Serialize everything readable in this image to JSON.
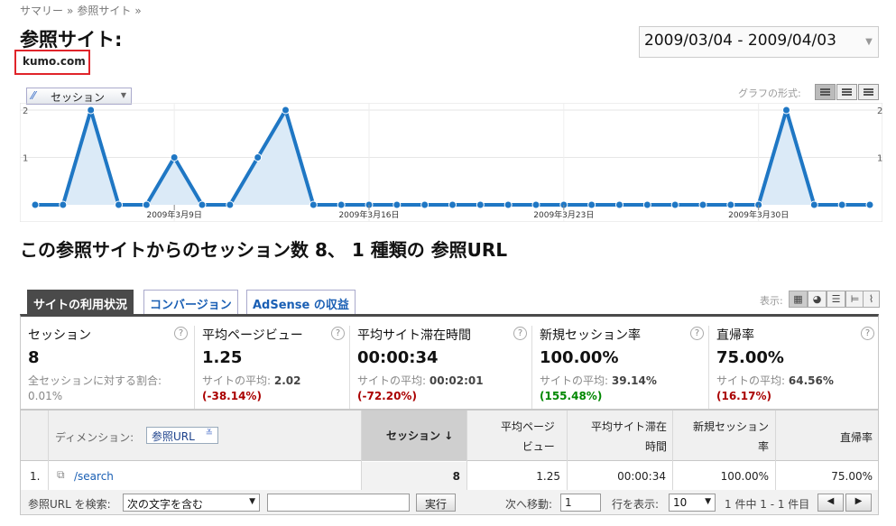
{
  "breadcrumb": {
    "items": [
      "サマリー",
      "参照サイト"
    ],
    "separator": "»"
  },
  "page": {
    "title": "参照サイト:",
    "site": "kumo.com"
  },
  "date_range": {
    "text": "2009/03/04 - 2009/04/03"
  },
  "graph": {
    "metric_label": "セッション",
    "type_label": "グラフの形式:",
    "y_ticks": [
      "2",
      "1"
    ],
    "x_tick_labels": [
      "2009年3月9日",
      "2009年3月16日",
      "2009年3月23日",
      "2009年3月30日"
    ],
    "line_color": "#1f77c4",
    "fill_color": "#dbeaf7"
  },
  "chart_data": {
    "type": "area",
    "series": [
      {
        "values": [
          0,
          0,
          2,
          0,
          0,
          1,
          0,
          0,
          1,
          2,
          0,
          0,
          0,
          0,
          0,
          0,
          0,
          0,
          0,
          0,
          0,
          0,
          0,
          0,
          0,
          0,
          0,
          2,
          0,
          0,
          0
        ]
      }
    ],
    "x": [
      "3/4",
      "3/5",
      "3/6",
      "3/7",
      "3/8",
      "3/9",
      "3/10",
      "3/11",
      "3/12",
      "3/13",
      "3/14",
      "3/15",
      "3/16",
      "3/17",
      "3/18",
      "3/19",
      "3/20",
      "3/21",
      "3/22",
      "3/23",
      "3/24",
      "3/25",
      "3/26",
      "3/27",
      "3/28",
      "3/29",
      "3/30",
      "3/31",
      "4/1",
      "4/2",
      "4/3"
    ],
    "x_tick_labels": [
      "2009年3月9日",
      "2009年3月16日",
      "2009年3月23日",
      "2009年3月30日"
    ],
    "ylim": [
      0,
      2
    ],
    "y_ticks": [
      1,
      2
    ],
    "grid": true
  },
  "summary": {
    "title": "この参照サイトからのセッション数 8、 1 種類の 参照URL"
  },
  "tabs": [
    {
      "label": "サイトの利用状況",
      "active": true
    },
    {
      "label": "コンバージョン",
      "active": false
    },
    {
      "label": "AdSense の収益",
      "active": false
    }
  ],
  "view": {
    "label": "表示:"
  },
  "scorecard": [
    {
      "title": "セッション",
      "value": "8",
      "sub_label": "全セッションに対する割合:",
      "sub_value": "0.01%",
      "pct": ""
    },
    {
      "title": "平均ページビュー",
      "value": "1.25",
      "sub_label": "サイトの平均:",
      "sub_value": "2.02",
      "pct": "(-38.14%)"
    },
    {
      "title": "平均サイト滞在時間",
      "value": "00:00:34",
      "sub_label": "サイトの平均:",
      "sub_value": "00:02:01",
      "pct": "(-72.20%)"
    },
    {
      "title": "新規セッション率",
      "value": "100.00%",
      "sub_label": "サイトの平均:",
      "sub_value": "39.14%",
      "pct": "(155.48%)"
    },
    {
      "title": "直帰率",
      "value": "75.00%",
      "sub_label": "サイトの平均:",
      "sub_value": "64.56%",
      "pct": "(16.17%)"
    }
  ],
  "table": {
    "dimension_label": "ディメンション:",
    "dimension_value": "参照URL",
    "headers": {
      "sessions": "セッション ↓",
      "pageviews_1": "平均ページ",
      "pageviews_2": "ビュー",
      "time_1": "平均サイト滞在",
      "time_2": "時間",
      "new_1": "新規セッション",
      "new_2": "率",
      "bounce": "直帰率"
    },
    "rows": [
      {
        "index": "1.",
        "url": "/search",
        "sessions": "8",
        "pageviews": "1.25",
        "time": "00:00:34",
        "new_rate": "100.00%",
        "bounce": "75.00%"
      }
    ]
  },
  "footer": {
    "search_label": "参照URL を検索:",
    "match_option": "次の文字を含む",
    "search_value": "",
    "go_button": "実行",
    "goto_label": "次へ移動:",
    "goto_value": "1",
    "rows_label": "行を表示:",
    "rows_value": "10",
    "range_text": "1 件中 1 - 1 件目",
    "prev": "◀",
    "next": "▶"
  }
}
